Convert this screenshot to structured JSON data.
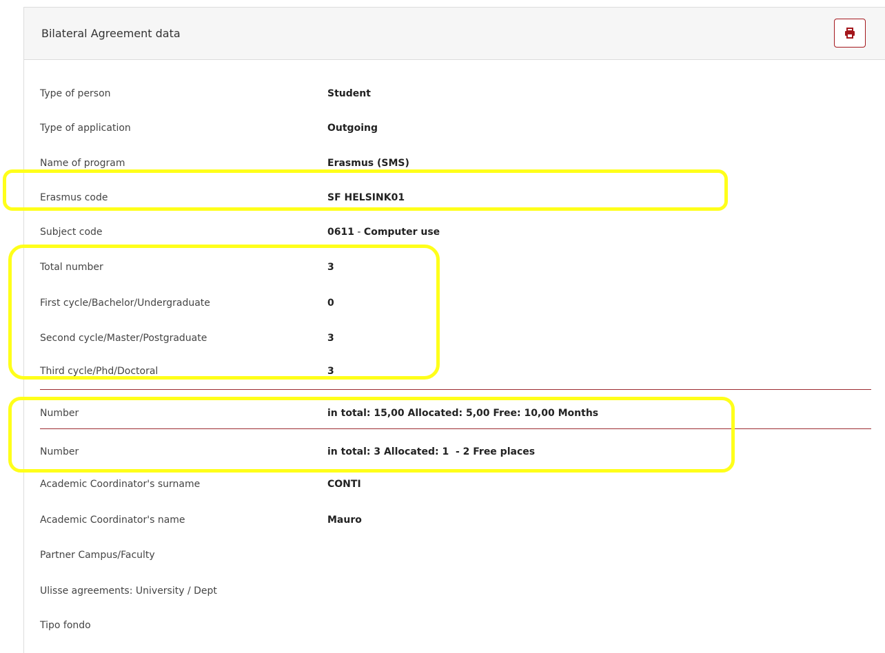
{
  "panel": {
    "title": "Bilateral Agreement data",
    "print_icon": "print-icon"
  },
  "rows": [
    {
      "label": "Type of person",
      "value": "Student"
    },
    {
      "label": "Type of application",
      "value": "Outgoing"
    },
    {
      "label": "Name of program",
      "value": "Erasmus (SMS)"
    },
    {
      "label": "Erasmus code",
      "value": "SF HELSINK01"
    },
    {
      "label": "Subject code",
      "value_code": "0611",
      "value_sep": " - ",
      "value_name": "Computer use"
    },
    {
      "label": "Total number",
      "value": "3"
    },
    {
      "label": "First cycle/Bachelor/Undergraduate",
      "value": "0"
    },
    {
      "label": "Second cycle/Master/Postgraduate",
      "value": "3"
    },
    {
      "label": "Third cycle/Phd/Doctoral",
      "value": "3"
    },
    {
      "label": "Number",
      "value": "in total: 15,00 Allocated: 5,00 Free: 10,00 Months"
    },
    {
      "label": "Number",
      "value": "in total: 3 Allocated: 1  - 2 Free places"
    },
    {
      "label": "Academic Coordinator's surname",
      "value": "CONTI"
    },
    {
      "label": "Academic Coordinator's name",
      "value": "Mauro"
    },
    {
      "label": "Partner Campus/Faculty",
      "value": ""
    },
    {
      "label": "Ulisse agreements: University / Dept",
      "value": ""
    },
    {
      "label": "Tipo fondo",
      "value": ""
    }
  ],
  "colors": {
    "accent": "#a3161b",
    "separator": "#9b2a30",
    "highlight": "#ffff1a"
  }
}
